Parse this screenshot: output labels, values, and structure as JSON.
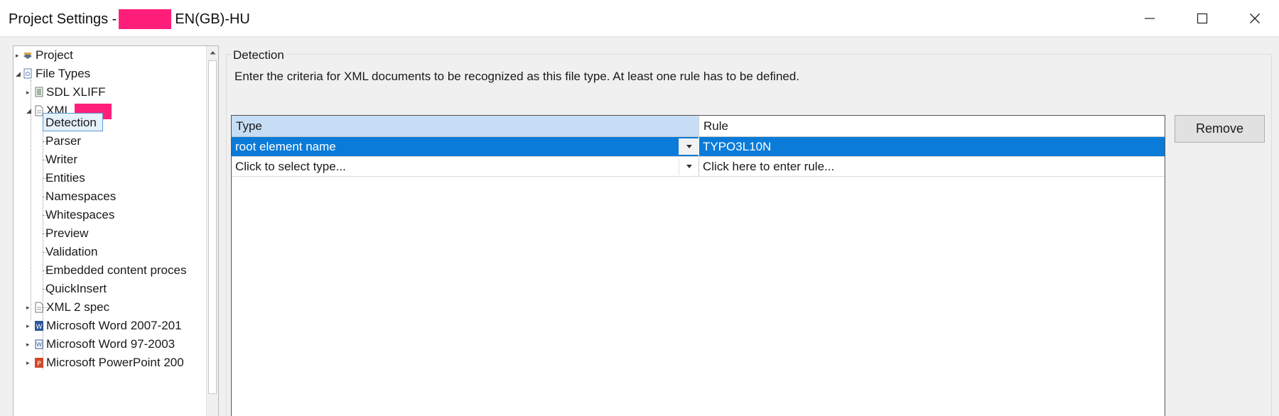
{
  "window": {
    "title_prefix": "Project Settings -",
    "title_suffix": "EN(GB)-HU",
    "controls": [
      "minimize",
      "maximize",
      "close"
    ]
  },
  "tree": {
    "items": [
      {
        "label": "Project",
        "icon": "project-icon"
      },
      {
        "label": "File Types",
        "icon": "file-types-icon"
      },
      {
        "label": "SDL XLIFF",
        "icon": "xliff-icon"
      },
      {
        "label": "XML B",
        "icon": "xml-file-icon"
      },
      {
        "label": "Detection"
      },
      {
        "label": "Parser"
      },
      {
        "label": "Writer"
      },
      {
        "label": "Entities"
      },
      {
        "label": "Namespaces"
      },
      {
        "label": "Whitespaces"
      },
      {
        "label": "Preview"
      },
      {
        "label": "Validation"
      },
      {
        "label": "Embedded content proces"
      },
      {
        "label": "QuickInsert"
      },
      {
        "label": "XML 2 spec",
        "icon": "xml-file-icon"
      },
      {
        "label": "Microsoft Word 2007-201",
        "icon": "word-icon"
      },
      {
        "label": "Microsoft Word 97-2003",
        "icon": "word-legacy-icon"
      },
      {
        "label": "Microsoft PowerPoint 200",
        "icon": "powerpoint-icon"
      }
    ],
    "selected": "Detection"
  },
  "detection": {
    "group_title": "Detection",
    "description": "Enter the criteria for XML documents to be recognized as this file type. At least one rule has to be defined.",
    "columns": {
      "type": "Type",
      "rule": "Rule"
    },
    "rows": [
      {
        "type": "root element name",
        "rule": "TYPO3L10N"
      },
      {
        "type": "Click to select type...",
        "rule": "Click here to enter rule..."
      }
    ],
    "remove_label": "Remove"
  },
  "colors": {
    "accent": "#0a7bd8",
    "header_highlight": "#c5def5",
    "redaction": "#ff1f7a"
  }
}
